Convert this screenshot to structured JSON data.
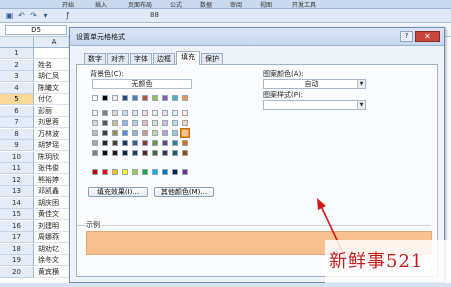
{
  "excel": {
    "ribbon_tabs": [
      "开始",
      "插入",
      "页面布局",
      "公式",
      "数据",
      "审阅",
      "视图",
      "开发工具"
    ],
    "name_box": "D5",
    "formula_hint": "88",
    "column_a": "A",
    "rows": [
      {
        "num": "1",
        "value": ""
      },
      {
        "num": "2",
        "value": "姓名"
      },
      {
        "num": "3",
        "value": "胡仁凤"
      },
      {
        "num": "4",
        "value": "陈曦文"
      },
      {
        "num": "5",
        "value": "付亿"
      },
      {
        "num": "6",
        "value": "彭丽"
      },
      {
        "num": "7",
        "value": "刘思蓉"
      },
      {
        "num": "8",
        "value": "万林波"
      },
      {
        "num": "9",
        "value": "胡梦瑶"
      },
      {
        "num": "10",
        "value": "陈玥欣"
      },
      {
        "num": "11",
        "value": "张伟俊"
      },
      {
        "num": "12",
        "value": "熊裕婷"
      },
      {
        "num": "13",
        "value": "邓凯鑫"
      },
      {
        "num": "14",
        "value": "胡庆困"
      },
      {
        "num": "15",
        "value": "黄佳文"
      },
      {
        "num": "16",
        "value": "刘建明"
      },
      {
        "num": "17",
        "value": "周娜燕"
      },
      {
        "num": "18",
        "value": "胡劝钇"
      },
      {
        "num": "19",
        "value": "徐冬文"
      },
      {
        "num": "20",
        "value": "黄宾横"
      }
    ],
    "selected_row": "5"
  },
  "dialog": {
    "title": "设置单元格格式",
    "help": "?",
    "close": "✕",
    "tabs": [
      "数字",
      "对齐",
      "字体",
      "边框",
      "填充",
      "保护"
    ],
    "active_tab": "填充",
    "background_color_label": "背景色(C):",
    "no_color_button": "无颜色",
    "fill_effects_button": "填充效果(I)...",
    "more_colors_button": "其他颜色(M)...",
    "pattern_color_label": "图案颜色(A):",
    "pattern_color_value": "自动",
    "pattern_style_label": "图案样式(P):",
    "pattern_style_value": "",
    "sample_label": "示例",
    "sample_color": "#f8c08e"
  },
  "palette": {
    "theme_top": [
      "#ffffff",
      "#000000",
      "#eeece1",
      "#1f497d",
      "#4f81bd",
      "#c0504d",
      "#9bbb59",
      "#8064a2",
      "#4bacc6",
      "#f79646"
    ],
    "theme_shades": [
      [
        "#f2f2f2",
        "#7f7f7f",
        "#ddd9c3",
        "#c6d9f0",
        "#dbe5f1",
        "#f2dcdb",
        "#ebf1dd",
        "#e5e0ec",
        "#dbeef3",
        "#fdeada"
      ],
      [
        "#d8d8d8",
        "#595959",
        "#c4bd97",
        "#8db3e2",
        "#b8cce4",
        "#e5b9b7",
        "#d7e3bc",
        "#ccc1d9",
        "#b7dde8",
        "#fbd5b5"
      ],
      [
        "#bfbfbf",
        "#3f3f3f",
        "#938953",
        "#548dd4",
        "#95b3d7",
        "#d99694",
        "#c3d69b",
        "#b2a2c7",
        "#92cddc",
        "#fac08f"
      ],
      [
        "#a5a5a5",
        "#262626",
        "#494429",
        "#17365d",
        "#366092",
        "#953734",
        "#76923c",
        "#5f497a",
        "#31859b",
        "#e36c09"
      ],
      [
        "#7f7f7f",
        "#0c0c0c",
        "#1d1b10",
        "#0f243e",
        "#244061",
        "#632423",
        "#4f6128",
        "#3f3151",
        "#205867",
        "#974806"
      ]
    ],
    "standard": [
      "#c00000",
      "#ff0000",
      "#ffc000",
      "#ffff00",
      "#92d050",
      "#00b050",
      "#00b0f0",
      "#0070c0",
      "#002060",
      "#7030a0"
    ],
    "selected": "#fac08f"
  },
  "annotation": {
    "arrow_color": "#d01818",
    "watermark": "新鲜事521",
    "watermark_color": "#c81a1a"
  }
}
